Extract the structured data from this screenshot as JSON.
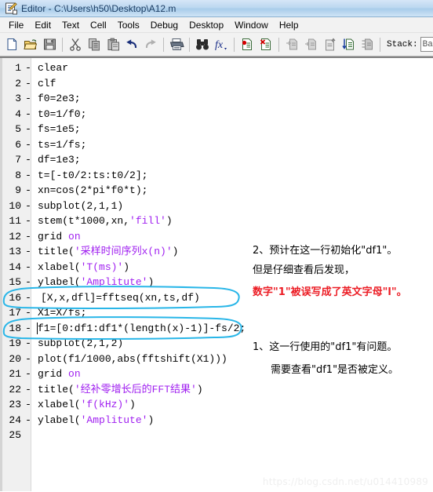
{
  "window": {
    "title": "Editor - C:\\Users\\h50\\Desktop\\A12.m",
    "icon": "editor-document-pencil-icon"
  },
  "menubar": {
    "items": [
      {
        "label": "File"
      },
      {
        "label": "Edit"
      },
      {
        "label": "Text"
      },
      {
        "label": "Cell"
      },
      {
        "label": "Tools"
      },
      {
        "label": "Debug"
      },
      {
        "label": "Desktop"
      },
      {
        "label": "Window"
      },
      {
        "label": "Help"
      }
    ]
  },
  "toolbar": {
    "buttons": [
      {
        "name": "new-file-icon",
        "tooltip": "New"
      },
      {
        "name": "open-folder-icon",
        "tooltip": "Open"
      },
      {
        "name": "save-icon",
        "tooltip": "Save"
      },
      {
        "name": "cut-scissors-icon",
        "tooltip": "Cut"
      },
      {
        "name": "copy-icon",
        "tooltip": "Copy"
      },
      {
        "name": "paste-icon",
        "tooltip": "Paste"
      },
      {
        "name": "undo-arrow-icon",
        "tooltip": "Undo"
      },
      {
        "name": "redo-arrow-icon",
        "tooltip": "Redo"
      },
      {
        "name": "print-icon",
        "tooltip": "Print"
      },
      {
        "name": "find-binoculars-icon",
        "tooltip": "Find"
      },
      {
        "name": "function-fx-icon",
        "tooltip": "Function Browser"
      },
      {
        "name": "set-breakpoint-icon",
        "tooltip": "Set/Clear Breakpoint"
      },
      {
        "name": "clear-breakpoints-icon",
        "tooltip": "Clear All Breakpoints"
      },
      {
        "name": "step-icon",
        "tooltip": "Step"
      },
      {
        "name": "step-in-icon",
        "tooltip": "Step In"
      },
      {
        "name": "step-out-icon",
        "tooltip": "Step Out"
      },
      {
        "name": "continue-icon",
        "tooltip": "Continue"
      },
      {
        "name": "exit-debug-icon",
        "tooltip": "Exit Debug Mode"
      }
    ],
    "stack_label": "Stack:",
    "stack_value": "Ba"
  },
  "editor": {
    "lines": [
      {
        "num": "1",
        "dash": "-",
        "text": "clear"
      },
      {
        "num": "2",
        "dash": "-",
        "text": "clf"
      },
      {
        "num": "3",
        "dash": "-",
        "text": "f0=2e3;"
      },
      {
        "num": "4",
        "dash": "-",
        "text": "t0=1/f0;"
      },
      {
        "num": "5",
        "dash": "-",
        "text": "fs=1e5;"
      },
      {
        "num": "6",
        "dash": "-",
        "text": "ts=1/fs;"
      },
      {
        "num": "7",
        "dash": "-",
        "text": "df=1e3;"
      },
      {
        "num": "8",
        "dash": "-",
        "text": "t=[-t0/2:ts:t0/2];"
      },
      {
        "num": "9",
        "dash": "-",
        "text": "xn=cos(2*pi*f0*t);"
      },
      {
        "num": "10",
        "dash": "-",
        "text": "subplot(2,1,1)"
      },
      {
        "num": "11",
        "dash": "-",
        "pre": "stem(t*1000,xn,",
        "str": "'fill'",
        "post": ")"
      },
      {
        "num": "12",
        "dash": "-",
        "pre": "grid ",
        "kw": "on",
        "post": ""
      },
      {
        "num": "13",
        "dash": "-",
        "pre": "title(",
        "str": "'采样时间序列x(n)'",
        "post": ")"
      },
      {
        "num": "14",
        "dash": "-",
        "pre": "xlabel(",
        "str": "'T(ms)'",
        "post": ")"
      },
      {
        "num": "15",
        "dash": "-",
        "pre": "ylabel(",
        "str": "'Amplitute'",
        "post": ")"
      },
      {
        "num": "16",
        "dash": "-",
        "text": "[X,x,dfl]=fftseq(xn,ts,df)"
      },
      {
        "num": "17",
        "dash": "-",
        "text": "X1=X/fs;"
      },
      {
        "num": "18",
        "dash": "-",
        "text": "f1=[0:df1:df1*(length(x)-1)]-fs/2;"
      },
      {
        "num": "19",
        "dash": "-",
        "text": "subplot(2,1,2)"
      },
      {
        "num": "20",
        "dash": "-",
        "text": "plot(f1/1000,abs(fftshift(X1)))"
      },
      {
        "num": "21",
        "dash": "-",
        "pre": "grid ",
        "kw": "on",
        "post": ""
      },
      {
        "num": "22",
        "dash": "-",
        "pre": "title(",
        "str": "'经补零增长后的FFT结果'",
        "post": ")"
      },
      {
        "num": "23",
        "dash": "-",
        "pre": "xlabel(",
        "str": "'f(kHz)'",
        "post": ")"
      },
      {
        "num": "24",
        "dash": "-",
        "pre": "ylabel(",
        "str": "'Amplitute'",
        "post": ")"
      },
      {
        "num": "25",
        "dash": "",
        "text": ""
      }
    ],
    "caret_line_index": 17
  },
  "annotations": {
    "highlight_color": "#29b6e8",
    "ellipses": [
      {
        "name": "line-16-highlight-ellipse",
        "line": "16"
      },
      {
        "name": "line-18-highlight-ellipse",
        "line": "18"
      }
    ],
    "notes": [
      {
        "name": "note-2-line-1",
        "text": "2、预计在这一行初始化\"df1\"。",
        "color": "#000000"
      },
      {
        "name": "note-2-line-2",
        "text": "但是仔细查看后发现，",
        "color": "#000000"
      },
      {
        "name": "note-2-line-3",
        "text": "数字\"1\"被误写成了英文字母\"l\"。",
        "color": "#ec1c24"
      },
      {
        "name": "note-1-line-1",
        "text": "1、这一行使用的\"df1\"有问题。",
        "color": "#000000"
      },
      {
        "name": "note-1-line-2",
        "text": "需要查看\"df1\"是否被定义。",
        "color": "#000000"
      }
    ]
  },
  "watermark": {
    "text": "https://blog.csdn.net/u014410989"
  }
}
